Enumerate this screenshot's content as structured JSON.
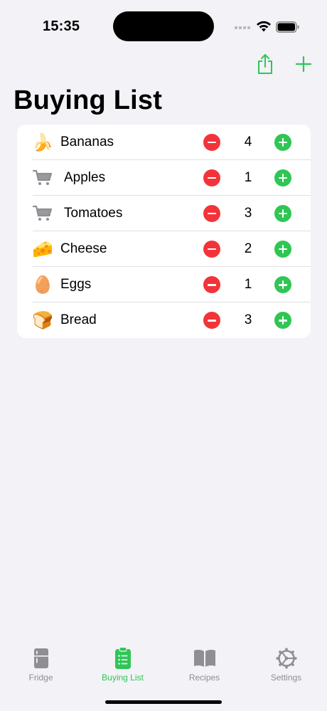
{
  "status": {
    "time": "15:35"
  },
  "toolbar": {
    "share_icon": "share-icon",
    "add_icon": "plus-icon",
    "accent": "#2fc654"
  },
  "title": "Buying List",
  "items": [
    {
      "icon": "🍌",
      "icon_name": "banana-icon",
      "name": "Bananas",
      "qty": "4"
    },
    {
      "icon": "cart",
      "icon_name": "cart-icon",
      "name": "Apples",
      "qty": "1"
    },
    {
      "icon": "cart",
      "icon_name": "cart-icon",
      "name": "Tomatoes",
      "qty": "3"
    },
    {
      "icon": "🧀",
      "icon_name": "cheese-icon",
      "name": "Cheese",
      "qty": "2"
    },
    {
      "icon": "🥚",
      "icon_name": "egg-icon",
      "name": "Eggs",
      "qty": "1"
    },
    {
      "icon": "🍞",
      "icon_name": "bread-icon",
      "name": "Bread",
      "qty": "3"
    }
  ],
  "tabs": [
    {
      "label": "Fridge",
      "icon": "fridge-icon",
      "active": false
    },
    {
      "label": "Buying List",
      "icon": "clipboard-list-icon",
      "active": true
    },
    {
      "label": "Recipes",
      "icon": "book-icon",
      "active": false
    },
    {
      "label": "Settings",
      "icon": "gear-icon",
      "active": false
    }
  ],
  "colors": {
    "minus": "#f2343a",
    "plus": "#2fc654",
    "inactive_tab": "#8e8e93"
  }
}
